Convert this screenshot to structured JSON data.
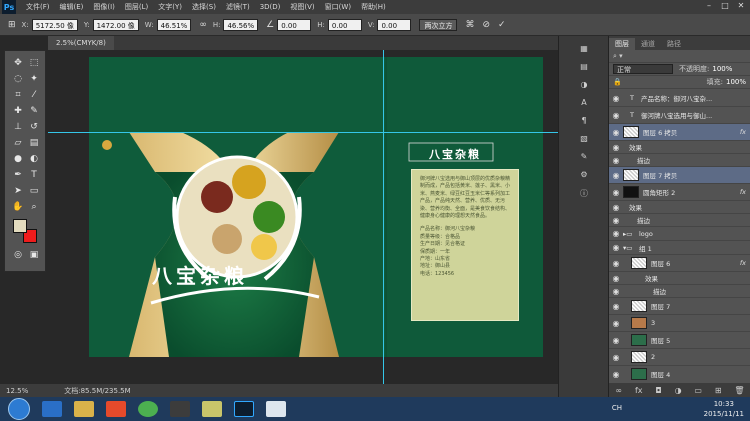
{
  "app": {
    "logo": "Ps"
  },
  "menu": [
    "文件(F)",
    "编辑(E)",
    "图像(I)",
    "图层(L)",
    "文字(Y)",
    "选择(S)",
    "滤镜(T)",
    "3D(D)",
    "视图(V)",
    "窗口(W)",
    "帮助(H)"
  ],
  "options": {
    "x_label": "X:",
    "x_value": "5172.50 像",
    "y_label": "Y:",
    "y_value": "1472.00 像",
    "w_label": "W:",
    "w_value": "46.51%",
    "h_label": "H:",
    "h_value": "46.56%",
    "angle_value": "0.00",
    "hskew_label": "H:",
    "hskew_value": "0.00",
    "vskew_label": "V:",
    "vskew_value": "0.00",
    "interp": "两次立方"
  },
  "document": {
    "tab_label": "2.5%(CMYK/8)"
  },
  "canvas": {
    "title": "八宝杂粮",
    "spec_title": "八宝杂粮",
    "description": "御河牌八宝选用与御山顶层的优质杂粮精制而成，产品包括黄米、莲子、黑米、小米、燕麦米、绿豆红豆玉米仁等系列加工产品，产品纯天然、营养、优质、无污染、营养均衡、全面，是美食饮食结构、健康身心健康的理想天然食品。",
    "spec_lines": [
      "产品名称：御河八宝杂粮",
      "质量等级：合格品",
      "生产日期：见合格证",
      "保质期：一年",
      "产地：山东省",
      "地址：御山县",
      "电话：123456"
    ]
  },
  "status": {
    "zoom": "12.5%",
    "doc": "文档:85.5M/235.5M"
  },
  "layers_panel": {
    "tabs": [
      "图层",
      "通道",
      "路径"
    ],
    "blend_mode": "正常",
    "opacity_label": "不透明度:",
    "opacity": "100%",
    "fill_label": "填充:",
    "fill": "100%",
    "rows": [
      {
        "name": "产品名称：御河八宝杂...",
        "type": "text",
        "selected": false,
        "fx": ""
      },
      {
        "name": "御河牌八宝选用与御山...",
        "type": "text",
        "selected": false,
        "fx": ""
      },
      {
        "name": "图层 6 拷贝",
        "type": "pixel",
        "selected": true,
        "fx": "fx"
      },
      {
        "name": "效果",
        "type": "effect",
        "selected": false,
        "fx": ""
      },
      {
        "name": "描边",
        "type": "effect",
        "selected": false,
        "fx": ""
      },
      {
        "name": "图层 7 拷贝",
        "type": "pixel",
        "selected": true,
        "fx": ""
      },
      {
        "name": "圆角矩形 2",
        "type": "pixel",
        "selected": false,
        "fx": "fx"
      },
      {
        "name": "效果",
        "type": "effect",
        "selected": false,
        "fx": ""
      },
      {
        "name": "描边",
        "type": "effect",
        "selected": false,
        "fx": ""
      },
      {
        "name": "logo",
        "type": "group",
        "selected": false,
        "fx": ""
      },
      {
        "name": "组 1",
        "type": "group",
        "selected": false,
        "fx": ""
      },
      {
        "name": "图层 6",
        "type": "pixel",
        "selected": false,
        "fx": "fx"
      },
      {
        "name": "效果",
        "type": "effect",
        "selected": false,
        "fx": ""
      },
      {
        "name": "描边",
        "type": "effect",
        "selected": false,
        "fx": ""
      },
      {
        "name": "图层 7",
        "type": "pixel",
        "selected": false,
        "fx": ""
      },
      {
        "name": "3",
        "type": "pixel",
        "selected": false,
        "fx": ""
      },
      {
        "name": "图层 5",
        "type": "pixel",
        "selected": false,
        "fx": ""
      },
      {
        "name": "2",
        "type": "pixel",
        "selected": false,
        "fx": ""
      },
      {
        "name": "图层 4",
        "type": "pixel",
        "selected": false,
        "fx": ""
      }
    ]
  },
  "taskbar": {
    "time": "10:33",
    "date": "2015/11/11",
    "ime": "CH"
  }
}
